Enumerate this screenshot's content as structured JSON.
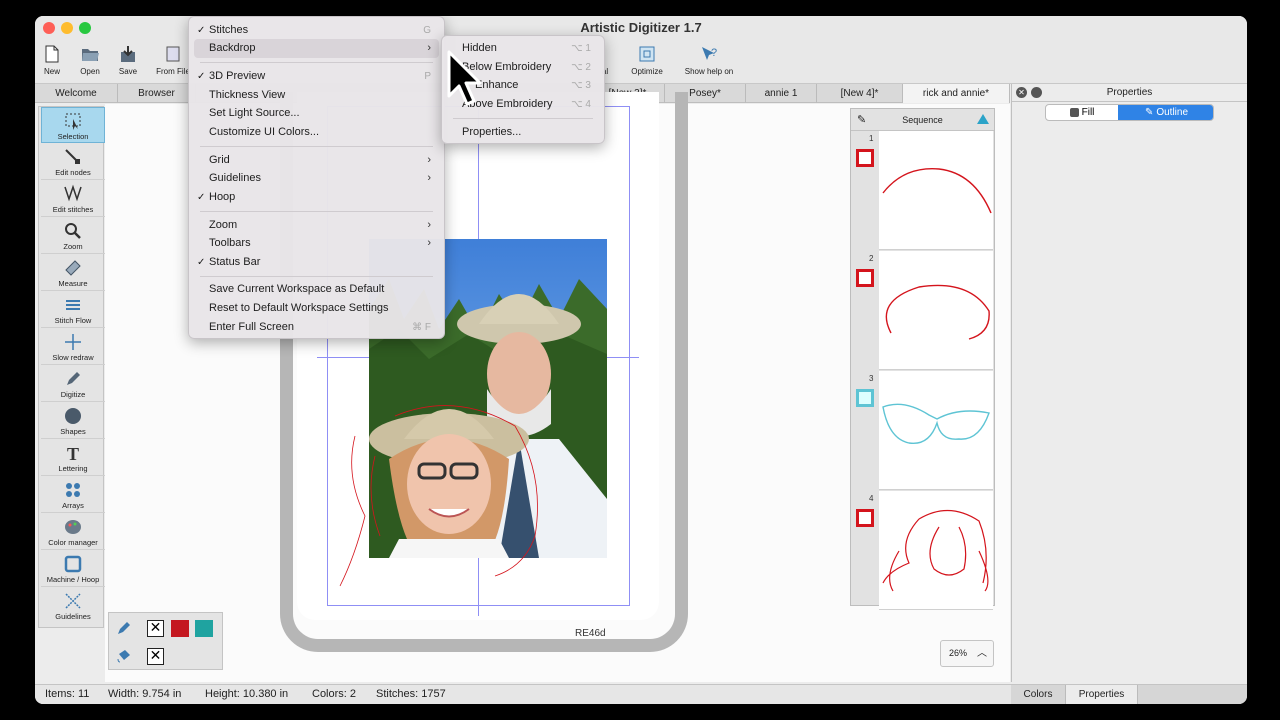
{
  "window": {
    "title": "Artistic Digitizer 1.7"
  },
  "toolbar": {
    "new": "New",
    "open": "Open",
    "save": "Save",
    "from_file": "From File",
    "al": "al",
    "optimize": "Optimize",
    "help": "Show help on"
  },
  "tabs": [
    "Welcome",
    "Browser",
    "[New 3]*",
    "Posey*",
    "annie 1",
    "[New 4]*",
    "rick and annie*"
  ],
  "left_tools": [
    "Selection",
    "Edit nodes",
    "Edit stitches",
    "Zoom",
    "Measure",
    "Stitch Flow",
    "Slow redraw",
    "Digitize",
    "Shapes",
    "Lettering",
    "Arrays",
    "Color manager",
    "Machine / Hoop",
    "Guidelines"
  ],
  "hoop_label": "RE46d",
  "sequence": {
    "title": "Sequence",
    "items": [
      {
        "num": "1",
        "color": "#d4141c"
      },
      {
        "num": "2",
        "color": "#d4141c"
      },
      {
        "num": "3",
        "color": "#5ec4d4"
      },
      {
        "num": "4",
        "color": "#d4141c"
      }
    ]
  },
  "zoom": {
    "value": "26%"
  },
  "properties": {
    "title": "Properties",
    "fill_tab": "Fill",
    "outline_tab": "Outline"
  },
  "status": {
    "items": "Items: 11",
    "width": "Width: 9.754 in",
    "height": "Height: 10.380 in",
    "colors": "Colors: 2",
    "stitches": "Stitches: 1757"
  },
  "bottom_tabs": {
    "colors": "Colors",
    "properties": "Properties"
  },
  "view_menu": {
    "stitches": "Stitches",
    "stitches_sc": "G",
    "backdrop": "Backdrop",
    "preview3d": "3D Preview",
    "preview3d_sc": "P",
    "thickness": "Thickness View",
    "light": "Set Light Source...",
    "customize": "Customize UI Colors...",
    "grid": "Grid",
    "guidelines": "Guidelines",
    "hoop": "Hoop",
    "zoom": "Zoom",
    "toolbars": "Toolbars",
    "statusbar": "Status Bar",
    "save_ws": "Save Current Workspace as Default",
    "reset_ws": "Reset to Default Workspace Settings",
    "fullscreen": "Enter Full Screen",
    "fullscreen_sc": "⌘ F"
  },
  "backdrop_menu": {
    "hidden": "Hidden",
    "hidden_sc": "⌥ 1",
    "below": "Below Embroidery",
    "below_sc": "⌥ 2",
    "enhance": "Enhance",
    "enhance_sc": "⌥ 3",
    "above": "Above Embroidery",
    "above_sc": "⌥ 4",
    "properties": "Properties..."
  }
}
